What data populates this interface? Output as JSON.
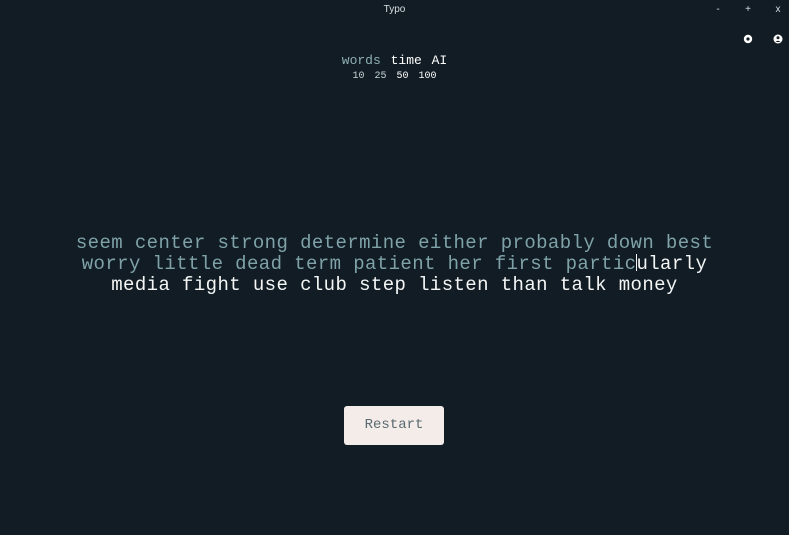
{
  "window": {
    "title": "Typo",
    "minimize": "-",
    "maximize": "+",
    "close": "x"
  },
  "icons": {
    "settings": "gear-icon",
    "account": "account-icon"
  },
  "modes": {
    "words": "words",
    "time": "time",
    "ai": "AI",
    "active": "time"
  },
  "counts": {
    "c10": "10",
    "c25": "25",
    "c50": "50",
    "c100": "100",
    "active": "50"
  },
  "typing": {
    "line1": "seem center strong determine either probably down best",
    "line2_typed": "worry little dead term patient her first partic",
    "line2_rest": "ularly",
    "line3": "media fight use club step listen than talk money"
  },
  "restart_label": "Restart",
  "colors": {
    "background": "#111c24",
    "typed_text": "#7fa2a8",
    "untyped_text": "#f4f6f6",
    "button_bg": "#f3ece9"
  }
}
